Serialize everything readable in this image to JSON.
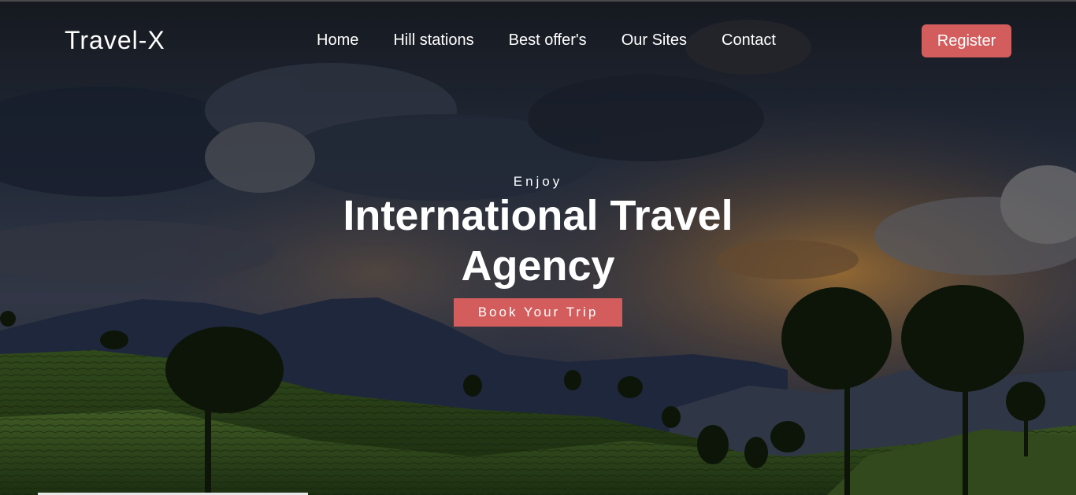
{
  "header": {
    "logo": "Travel-X",
    "nav": [
      "Home",
      "Hill stations",
      "Best offer's",
      "Our Sites",
      "Contact"
    ],
    "register_label": "Register"
  },
  "hero": {
    "kicker": "Enjoy",
    "headline": "International Travel Agency",
    "cta_label": "Book Your Trip"
  },
  "colors": {
    "accent": "#d35d5d",
    "text": "#ffffff"
  }
}
